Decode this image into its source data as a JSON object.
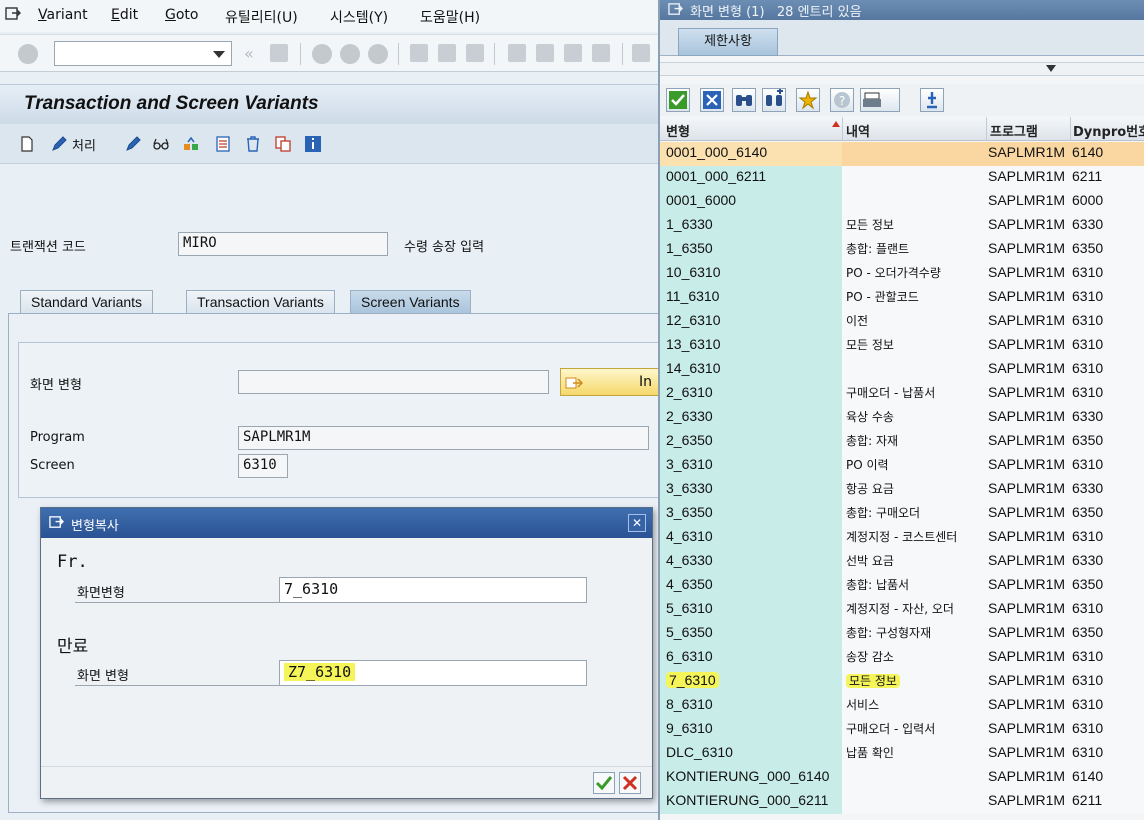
{
  "menubar": {
    "items": [
      {
        "label": "Variant",
        "hotkey_prefix": "",
        "hotkey": "V",
        "rest": "ariant"
      },
      {
        "label": "Edit",
        "hotkey": "E",
        "rest": "dit"
      },
      {
        "label": "Goto",
        "hotkey": "G",
        "rest": "oto"
      },
      {
        "label": "유틸리티(U)"
      },
      {
        "label": "시스템(Y)"
      },
      {
        "label": "도움말(H)"
      }
    ]
  },
  "page": {
    "title": "Transaction and Screen Variants",
    "process_label": "처리"
  },
  "form": {
    "tcode_label": "트랜잭션 코드",
    "tcode_value": "MIRO",
    "tcode_desc": "수령 송장 입력",
    "tabs": [
      "Standard Variants",
      "Transaction Variants",
      "Screen Variants"
    ],
    "screen_variant_label": "화면 변형",
    "screen_variant_value": "",
    "in_button": "In",
    "program_label": "Program",
    "program_value": "SAPLMR1M",
    "screen_label": "Screen",
    "screen_value": "6310"
  },
  "dialog": {
    "title": "변형복사",
    "from_label": "Fr.",
    "from_field_label": "화면변형",
    "from_value": "7_6310",
    "to_label": "만료",
    "to_field_label": "화면 변형",
    "to_value": "Z7_6310"
  },
  "right_panel": {
    "title": "화면 변형 (1)   28 엔트리 있음",
    "tab": "제한사항",
    "columns": [
      "변형",
      "내역",
      "프로그램",
      "Dynpro번호"
    ],
    "rows": [
      [
        "0001_000_6140",
        "",
        "SAPLMR1M",
        "6140"
      ],
      [
        "0001_000_6211",
        "",
        "SAPLMR1M",
        "6211"
      ],
      [
        "0001_6000",
        "",
        "SAPLMR1M",
        "6000"
      ],
      [
        "1_6330",
        "모든 정보",
        "SAPLMR1M",
        "6330"
      ],
      [
        "1_6350",
        "총합: 플랜트",
        "SAPLMR1M",
        "6350"
      ],
      [
        "10_6310",
        "PO - 오더가격수량",
        "SAPLMR1M",
        "6310"
      ],
      [
        "11_6310",
        "PO - 관할코드",
        "SAPLMR1M",
        "6310"
      ],
      [
        "12_6310",
        "이전",
        "SAPLMR1M",
        "6310"
      ],
      [
        "13_6310",
        "모든 정보",
        "SAPLMR1M",
        "6310"
      ],
      [
        "14_6310",
        "",
        "SAPLMR1M",
        "6310"
      ],
      [
        "2_6310",
        "구매오더 - 납품서",
        "SAPLMR1M",
        "6310"
      ],
      [
        "2_6330",
        "육상 수송",
        "SAPLMR1M",
        "6330"
      ],
      [
        "2_6350",
        "총합: 자재",
        "SAPLMR1M",
        "6350"
      ],
      [
        "3_6310",
        "PO 이력",
        "SAPLMR1M",
        "6310"
      ],
      [
        "3_6330",
        "항공 요금",
        "SAPLMR1M",
        "6330"
      ],
      [
        "3_6350",
        "총합: 구매오더",
        "SAPLMR1M",
        "6350"
      ],
      [
        "4_6310",
        "계정지정 - 코스트센터",
        "SAPLMR1M",
        "6310"
      ],
      [
        "4_6330",
        "선박 요금",
        "SAPLMR1M",
        "6330"
      ],
      [
        "4_6350",
        "총합: 납품서",
        "SAPLMR1M",
        "6350"
      ],
      [
        "5_6310",
        "계정지정 - 자산, 오더",
        "SAPLMR1M",
        "6310"
      ],
      [
        "5_6350",
        "총합: 구성형자재",
        "SAPLMR1M",
        "6350"
      ],
      [
        "6_6310",
        "송장 감소",
        "SAPLMR1M",
        "6310"
      ],
      [
        "7_6310",
        "모든 정보",
        "SAPLMR1M",
        "6310"
      ],
      [
        "8_6310",
        "서비스",
        "SAPLMR1M",
        "6310"
      ],
      [
        "9_6310",
        "구매오더 - 입력서",
        "SAPLMR1M",
        "6310"
      ],
      [
        "DLC_6310",
        "납품 확인",
        "SAPLMR1M",
        "6310"
      ],
      [
        "KONTIERUNG_000_6140",
        "",
        "SAPLMR1M",
        "6140"
      ],
      [
        "KONTIERUNG_000_6211",
        "",
        "SAPLMR1M",
        "6211"
      ]
    ]
  }
}
